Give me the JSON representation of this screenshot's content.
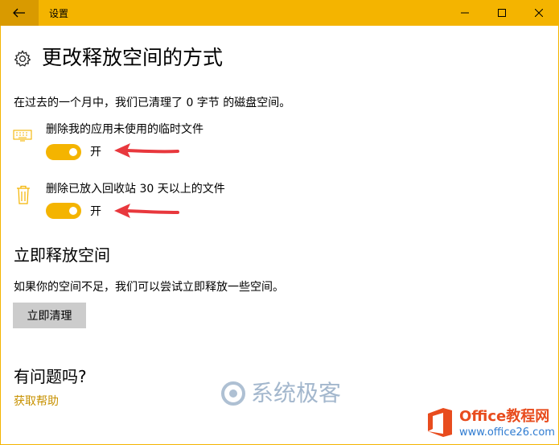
{
  "window": {
    "title": "设置"
  },
  "colors": {
    "accent": "#f4b400",
    "link": "#c79100",
    "arrow": "#e8383d"
  },
  "header": {
    "title": "更改释放空间的方式"
  },
  "summary": "在过去的一个月中，我们已清理了 0 字节 的磁盘空间。",
  "options": [
    {
      "icon": "keyboard-icon",
      "label": "删除我的应用未使用的临时文件",
      "state": "开",
      "on": true
    },
    {
      "icon": "trash-icon",
      "label": "删除已放入回收站 30 天以上的文件",
      "state": "开",
      "on": true
    }
  ],
  "free_now": {
    "heading": "立即释放空间",
    "description": "如果你的空间不足，我们可以尝试立即释放一些空间。",
    "button": "立即清理"
  },
  "help": {
    "heading": "有问题吗?",
    "link": "获取帮助"
  },
  "watermarks": {
    "center": "系统极客",
    "corner_brand": "Office教程网",
    "corner_url": "www.office26.com"
  }
}
